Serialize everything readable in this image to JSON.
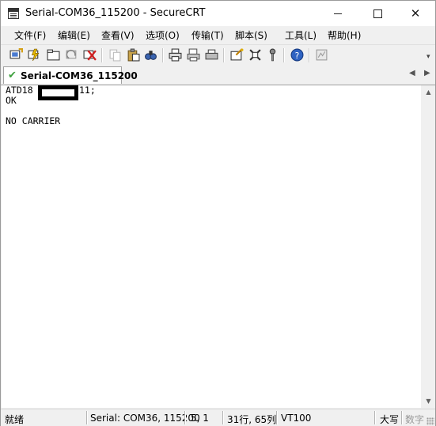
{
  "window": {
    "title": "Serial-COM36_115200 - SecureCRT",
    "minimize_label": "—",
    "maximize_label": "☐",
    "close_label": "✕"
  },
  "menu": [
    {
      "label": "文件(F)"
    },
    {
      "label": "编辑(E)"
    },
    {
      "label": "查看(V)"
    },
    {
      "label": "选项(O)"
    },
    {
      "label": "传输(T)"
    },
    {
      "label": "脚本(S)"
    },
    {
      "label": "工具(L)"
    },
    {
      "label": "帮助(H)"
    }
  ],
  "toolbar": {
    "icons": [
      "connect-icon",
      "quick-connect-icon",
      "connect-in-tab-icon",
      "reconnect-icon",
      "disconnect-icon",
      "copy-icon",
      "paste-icon",
      "find-icon",
      "print-icon",
      "print-selection-icon",
      "print-setup-icon",
      "session-options-icon",
      "global-options-icon",
      "keymap-icon",
      "help-icon",
      "sftp-icon"
    ],
    "overflow_label": "▾"
  },
  "tabs": {
    "active_label": "Serial-COM36_115200",
    "status_check": "✔",
    "nav_left": "◀",
    "nav_right": "▶"
  },
  "terminal": {
    "lines": [
      "ATD18",
      "11;",
      "OK",
      "",
      "NO CARRIER"
    ]
  },
  "scrollbar": {
    "up": "▲",
    "down": "▼"
  },
  "status": {
    "ready": "就绪",
    "connection": "Serial: COM36, 115200",
    "cursor": "5,   1",
    "size": "31行, 65列",
    "emulation": "VT100",
    "caps": "大写",
    "num": "数字"
  },
  "colors": {
    "accent_check": "#3fa13f",
    "background": "#f0f0f0"
  }
}
